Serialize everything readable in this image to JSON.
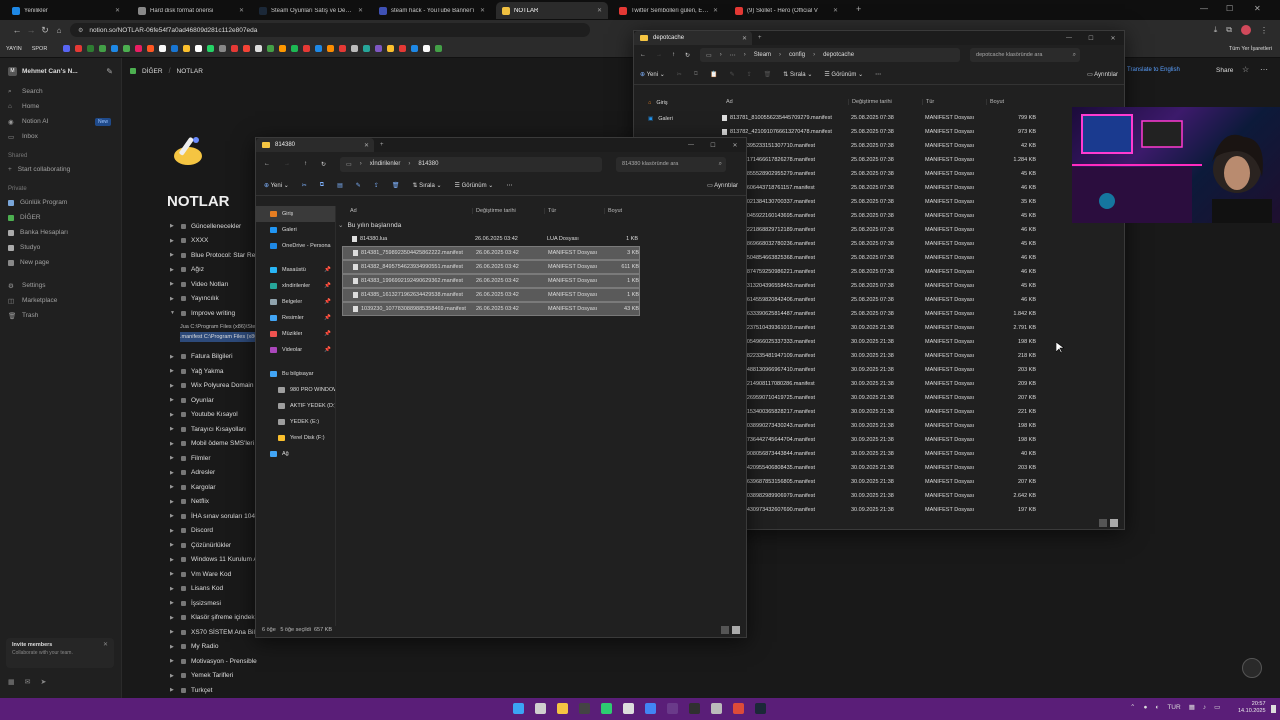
{
  "browser": {
    "tabs": [
      {
        "title": "Yenilikler",
        "color": "#1e88e5",
        "active": false
      },
      {
        "title": "Hard disk format önerisi",
        "color": "#888888",
        "active": false
      },
      {
        "title": "Steam Oyunları Satış ve Destek",
        "color": "#1b2838",
        "active": false
      },
      {
        "title": "steam hack - YouTube Banner'ı",
        "color": "#3f51b5",
        "active": false
      },
      {
        "title": "NOTLAR",
        "color": "#f0c040",
        "active": true
      },
      {
        "title": "Twitter Sembolleri gülen, Emoji",
        "color": "#e53935",
        "active": false
      },
      {
        "title": "(9) Skillet - Hero (Official V",
        "color": "#e53935",
        "active": false
      }
    ],
    "url": "notion.so/NOTLAR-06fe54f7a0ad46809d281c112e807eda",
    "bookmarks_left": [
      "YAYIN",
      "SPOR"
    ],
    "bookmarks_right": "Tüm Yer İşaretleri",
    "bookmark_colors": [
      "#5865f2",
      "#e53935",
      "#2e7d32",
      "#43a047",
      "#1e88e5",
      "#4caf50",
      "#e91e63",
      "#ff5722",
      "#fafafa",
      "#1976d2",
      "#fbc02d",
      "#ffffff",
      "#25d366",
      "#888888",
      "#e53935",
      "#f44336",
      "#dddddd",
      "#43a047",
      "#ff9800",
      "#1db954",
      "#e53935",
      "#1e88e5",
      "#fb8c00",
      "#e53935",
      "#bbbbbb",
      "#26a69a",
      "#7e57c2",
      "#fbc02d",
      "#e53935",
      "#1e88e5",
      "#fafafa",
      "#43a047"
    ]
  },
  "notion": {
    "workspace": "Mehmet Can's N...",
    "nav": [
      {
        "icon": "search-icon",
        "label": "Search"
      },
      {
        "icon": "home-icon",
        "label": "Home"
      },
      {
        "icon": "ai-icon",
        "label": "Notion AI",
        "badge": "New"
      },
      {
        "icon": "inbox-icon",
        "label": "Inbox"
      }
    ],
    "shared_label": "Shared",
    "start_collab": "Start collaborating",
    "private_label": "Private",
    "private_items": [
      "Günlük Program",
      "DİĞER",
      "Banka Hesapları",
      "Studyo",
      "New page"
    ],
    "bottom_items": [
      "Settings",
      "Marketplace",
      "Trash"
    ],
    "invite_title": "Invite members",
    "invite_sub": "Collaborate with your team.",
    "breadcrumb": [
      "DİĞER",
      "NOTLAR"
    ],
    "share": "Share",
    "translate": "Translate to English",
    "page_title": "NOTLAR",
    "tree": [
      "Güncellenecekler",
      "XXXX",
      "Blue Protocol: Star Resonance",
      "Ağız",
      "Video Notları",
      "Yayıncılık",
      "Improve writing",
      "",
      "",
      "Fatura Bilgileri",
      "Yağ Yakma",
      "Wix Polyurea Domain Bilgileri",
      "Oyunlar",
      "Youtube Kısayol",
      "Tarayıcı Kısayolları",
      "Mobil ödeme SMS'leri",
      "Filmler",
      "Adresler",
      "Kargolar",
      "Netflix",
      "İHA sınav soruları 1044123",
      "Discord",
      "Çözünürlükler",
      "Windows 11 Kurulum Adımları",
      "Vm Ware Kod",
      "Lisans Kod",
      "İşsizsmesi",
      "Klasör şifreme içindeki",
      "XS70 SİSTEM Ana Bileşenleri",
      "My Radio",
      "Motivasyon - Prensible",
      "Yemek Tarifleri",
      "Turkçet"
    ],
    "code_line1": "Jua C:\\Program Files (x86)\\Steam\\config\\stplug-in",
    "code_line2": ".manifest C:\\Program Files (x86)\\Steam\\config\\depotcache"
  },
  "explorer1": {
    "tab_title": "814380",
    "path": [
      "xİndirilenler",
      "814380"
    ],
    "search_placeholder": "814380 klasöründe ara",
    "toolbar": {
      "new": "Yeni",
      "sort": "Sırala",
      "view": "Görünüm",
      "details": "Ayrıntılar"
    },
    "columns": [
      "Ad",
      "Değiştirme tarihi",
      "Tür",
      "Boyut"
    ],
    "group_label": "Bu yılın başlarında",
    "files": [
      {
        "name": "814380.lua",
        "date": "26.06.2025 03:42",
        "type": "LUA Dosyası",
        "size": "1 KB",
        "selected": false
      },
      {
        "name": "814381_7598923504425862222.manifest",
        "date": "26.06.2025 03:42",
        "type": "MANIFEST Dosyası",
        "size": "3 KB",
        "selected": true
      },
      {
        "name": "814382_8495754623934990551.manifest",
        "date": "26.06.2025 03:42",
        "type": "MANIFEST Dosyası",
        "size": "611 KB",
        "selected": true
      },
      {
        "name": "814383_1996992192490629362.manifest",
        "date": "26.06.2025 03:42",
        "type": "MANIFEST Dosyası",
        "size": "1 KB",
        "selected": true
      },
      {
        "name": "814385_1613271962634429538.manifest",
        "date": "26.06.2025 03:42",
        "type": "MANIFEST Dosyası",
        "size": "1 KB",
        "selected": true
      },
      {
        "name": "1039230_1077830889885358469.manifest",
        "date": "26.06.2025 03:42",
        "type": "MANIFEST Dosyası",
        "size": "43 KB",
        "selected": true
      }
    ],
    "nav": [
      {
        "label": "Giriş",
        "color": "#e67e22",
        "pin": false
      },
      {
        "label": "Galeri",
        "color": "#2196f3",
        "pin": false
      },
      {
        "label": "OneDrive - Persona",
        "color": "#1e88e5",
        "pin": false
      },
      {
        "label": "Masaüstü",
        "color": "#29b6f6",
        "pin": true
      },
      {
        "label": "xİndirilenler",
        "color": "#26a69a",
        "pin": true
      },
      {
        "label": "Belgeler",
        "color": "#90a4ae",
        "pin": true
      },
      {
        "label": "Resimler",
        "color": "#42a5f5",
        "pin": true
      },
      {
        "label": "Müzikler",
        "color": "#ef5350",
        "pin": true
      },
      {
        "label": "Videolar",
        "color": "#ab47bc",
        "pin": true
      },
      {
        "label": "Bu bilgisayar",
        "color": "#42a5f5",
        "pin": false
      },
      {
        "label": "980 PRO WINDOWS (C:)",
        "color": "#9e9e9e",
        "pin": false
      },
      {
        "label": "AKTİF YEDEK (D:)",
        "color": "#9e9e9e",
        "pin": false
      },
      {
        "label": "YEDEK (E:)",
        "color": "#9e9e9e",
        "pin": false
      },
      {
        "label": "Yerel Disk (F:)",
        "color": "#fbc02d",
        "pin": false
      },
      {
        "label": "Ağ",
        "color": "#42a5f5",
        "pin": false
      }
    ],
    "status": "6 öğe   5 öğe seçildi  657 KB"
  },
  "explorer2": {
    "tab_title": "depotcache",
    "path": [
      "Steam",
      "config",
      "depotcache"
    ],
    "search_placeholder": "depotcache klasöründe ara",
    "toolbar": {
      "new": "Yeni",
      "sort": "Sırala",
      "view": "Görünüm",
      "details": "Ayrıntılar"
    },
    "columns": [
      "Ad",
      "Değiştirme tarihi",
      "Tür",
      "Boyut"
    ],
    "nav": [
      "Giriş",
      "Galeri"
    ],
    "files": [
      {
        "name": "813781_8100556235445709279.manifest",
        "date": "25.08.2025 07:38",
        "type": "MANIFEST Dosyası",
        "size": "799 KB"
      },
      {
        "name": "813782_4210910766613270478.manifest",
        "date": "25.08.2025 07:38",
        "type": "MANIFEST Dosyası",
        "size": "973 KB"
      },
      {
        "name": "...9047395233151307710.manifest",
        "date": "25.08.2025 07:38",
        "type": "MANIFEST Dosyası",
        "size": "42 KB"
      },
      {
        "name": "...2489171466617826278.manifest",
        "date": "25.08.2025 07:38",
        "type": "MANIFEST Dosyası",
        "size": "1.284 KB"
      },
      {
        "name": "...3336855528902955279.manifest",
        "date": "25.08.2025 07:38",
        "type": "MANIFEST Dosyası",
        "size": "45 KB"
      },
      {
        "name": "...2444606443718761157.manifest",
        "date": "25.08.2025 07:38",
        "type": "MANIFEST Dosyası",
        "size": "46 KB"
      },
      {
        "name": "...5258021384130700337.manifest",
        "date": "25.08.2025 07:38",
        "type": "MANIFEST Dosyası",
        "size": "35 KB"
      },
      {
        "name": "...4909045922160143695.manifest",
        "date": "25.08.2025 07:38",
        "type": "MANIFEST Dosyası",
        "size": "45 KB"
      },
      {
        "name": "...3000221868829712189.manifest",
        "date": "25.08.2025 07:38",
        "type": "MANIFEST Dosyası",
        "size": "46 KB"
      },
      {
        "name": "...3897869668032780236.manifest",
        "date": "25.08.2025 07:38",
        "type": "MANIFEST Dosyası",
        "size": "45 KB"
      },
      {
        "name": "...2988504854663825368.manifest",
        "date": "25.08.2025 07:38",
        "type": "MANIFEST Dosyası",
        "size": "46 KB"
      },
      {
        "name": "...5455874759250986221.manifest",
        "date": "25.08.2025 07:38",
        "type": "MANIFEST Dosyası",
        "size": "46 KB"
      },
      {
        "name": "...4693313204396558453.manifest",
        "date": "25.08.2025 07:38",
        "type": "MANIFEST Dosyası",
        "size": "45 KB"
      },
      {
        "name": "...2167614559820842406.manifest",
        "date": "25.08.2025 07:38",
        "type": "MANIFEST Dosyası",
        "size": "46 KB"
      },
      {
        "name": "...3349633390625814487.manifest",
        "date": "25.08.2025 07:38",
        "type": "MANIFEST Dosyası",
        "size": "1.842 KB"
      },
      {
        "name": "...3389237510439361019.manifest",
        "date": "30.09.2025 21:38",
        "type": "MANIFEST Dosyası",
        "size": "2.791 KB"
      },
      {
        "name": "...8193054966025337333.manifest",
        "date": "30.09.2025 21:38",
        "type": "MANIFEST Dosyası",
        "size": "198 KB"
      },
      {
        "name": "...2051822335481947109.manifest",
        "date": "30.09.2025 21:38",
        "type": "MANIFEST Dosyası",
        "size": "218 KB"
      },
      {
        "name": "...7478488130966967410.manifest",
        "date": "30.09.2025 21:38",
        "type": "MANIFEST Dosyası",
        "size": "203 KB"
      },
      {
        "name": "...7982214908117080286.manifest",
        "date": "30.09.2025 21:38",
        "type": "MANIFEST Dosyası",
        "size": "209 KB"
      },
      {
        "name": "...2059269590710419725.manifest",
        "date": "30.09.2025 21:38",
        "type": "MANIFEST Dosyası",
        "size": "207 KB"
      },
      {
        "name": "...5073153400365828217.manifest",
        "date": "30.09.2025 21:38",
        "type": "MANIFEST Dosyası",
        "size": "221 KB"
      },
      {
        "name": "...8836038990273430243.manifest",
        "date": "30.09.2025 21:38",
        "type": "MANIFEST Dosyası",
        "size": "198 KB"
      },
      {
        "name": "...2202736442745644704.manifest",
        "date": "30.09.2025 21:38",
        "type": "MANIFEST Dosyası",
        "size": "198 KB"
      },
      {
        "name": "...2318908056873443844.manifest",
        "date": "30.09.2025 21:38",
        "type": "MANIFEST Dosyası",
        "size": "40 KB"
      },
      {
        "name": "...4839420955406808435.manifest",
        "date": "30.09.2025 21:38",
        "type": "MANIFEST Dosyası",
        "size": "203 KB"
      },
      {
        "name": "...2293639687853156805.manifest",
        "date": "30.09.2025 21:38",
        "type": "MANIFEST Dosyası",
        "size": "207 KB"
      },
      {
        "name": "...6415038982989906979.manifest",
        "date": "30.09.2025 21:38",
        "type": "MANIFEST Dosyası",
        "size": "2.642 KB"
      },
      {
        "name": "...4454430973432607690.manifest",
        "date": "30.09.2025 21:38",
        "type": "MANIFEST Dosyası",
        "size": "197 KB"
      }
    ]
  },
  "taskbar": {
    "icons": [
      {
        "name": "start-icon",
        "color": "#3ba4f4"
      },
      {
        "name": "file-icon",
        "color": "#cfcfcf"
      },
      {
        "name": "explorer-icon",
        "color": "#f5c542"
      },
      {
        "name": "terminal-icon",
        "color": "#444444"
      },
      {
        "name": "play-icon",
        "color": "#2ecc71"
      },
      {
        "name": "gear-app-icon",
        "color": "#dddddd"
      },
      {
        "name": "chrome-icon",
        "color": "#4285f4"
      },
      {
        "name": "app-icon",
        "color": "#6a3a8a"
      },
      {
        "name": "obs-icon",
        "color": "#303030"
      },
      {
        "name": "settings-app-icon",
        "color": "#bbbbbb"
      },
      {
        "name": "git-app-icon",
        "color": "#dd4b39"
      },
      {
        "name": "steam-icon",
        "color": "#1b2838"
      }
    ],
    "lang": "TUR",
    "time": "20:57",
    "date": "14.10.2025"
  }
}
